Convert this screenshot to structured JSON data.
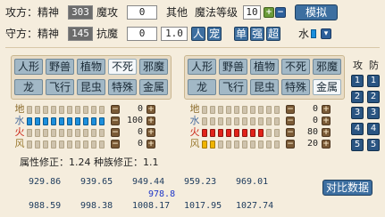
{
  "attack_row": {
    "label": "攻方：",
    "spirit_label": "精神",
    "spirit_value": "303",
    "magic_attack_label": "魔攻",
    "magic_attack_value": "0",
    "other_label": "其他",
    "magic_level_label": "魔法等级",
    "magic_level_value": "10",
    "simulate_button": "模拟"
  },
  "defense_row": {
    "label": "守方：",
    "spirit_label": "精神",
    "spirit_value": "145",
    "magic_resist_label": "抗魔",
    "magic_resist_value": "0",
    "factor_value": "1.0",
    "target_buttons": [
      "人",
      "宠"
    ],
    "mode_buttons": [
      "单",
      "强",
      "超"
    ],
    "element_label": "水"
  },
  "attacker_categories": {
    "row1": [
      "人形",
      "野兽",
      "植物",
      "不死",
      "邪魔"
    ],
    "row2": [
      "龙",
      "飞行",
      "昆虫",
      "特殊",
      "金属"
    ],
    "selected": "不死"
  },
  "defender_categories": {
    "row1": [
      "人形",
      "野兽",
      "植物",
      "不死",
      "邪魔"
    ],
    "row2": [
      "龙",
      "飞行",
      "昆虫",
      "特殊",
      "金属"
    ],
    "selected": "金属"
  },
  "column_headers": {
    "attack": "攻",
    "defense": "防"
  },
  "attacker_elements": [
    {
      "name": "地",
      "value": "0",
      "fill": 0,
      "color": "blue"
    },
    {
      "name": "水",
      "value": "100",
      "fill": 10,
      "color": "blue"
    },
    {
      "name": "火",
      "value": "0",
      "fill": 0,
      "color": "blue"
    },
    {
      "name": "风",
      "value": "0",
      "fill": 0,
      "color": "blue"
    }
  ],
  "defender_elements": [
    {
      "name": "地",
      "value": "0",
      "fill": 0,
      "color": "red"
    },
    {
      "name": "水",
      "value": "0",
      "fill": 0,
      "color": "red"
    },
    {
      "name": "火",
      "value": "80",
      "fill": 8,
      "color": "red"
    },
    {
      "name": "风",
      "value": "20",
      "fill": 2,
      "color": "yellow"
    }
  ],
  "slot_buttons": {
    "attack": [
      "1",
      "2",
      "3",
      "4",
      "5"
    ],
    "defense": [
      "1",
      "2",
      "3",
      "4",
      "5"
    ]
  },
  "correction_text": "属性修正：1.24 种族修正：1.1",
  "results": {
    "row1": [
      "929.86",
      "939.65",
      "949.44",
      "959.23",
      "969.01"
    ],
    "center": "978.8",
    "row2": [
      "988.59",
      "998.38",
      "1008.17",
      "1017.95",
      "1027.74"
    ]
  },
  "compare_button": "对比数据",
  "colors": {
    "background": "#f5eddd",
    "accent_blue": "#3d6fa0",
    "water_bar": "#1c8fdc",
    "fire_bar": "#e2231a",
    "wind_bar": "#f0b400"
  }
}
